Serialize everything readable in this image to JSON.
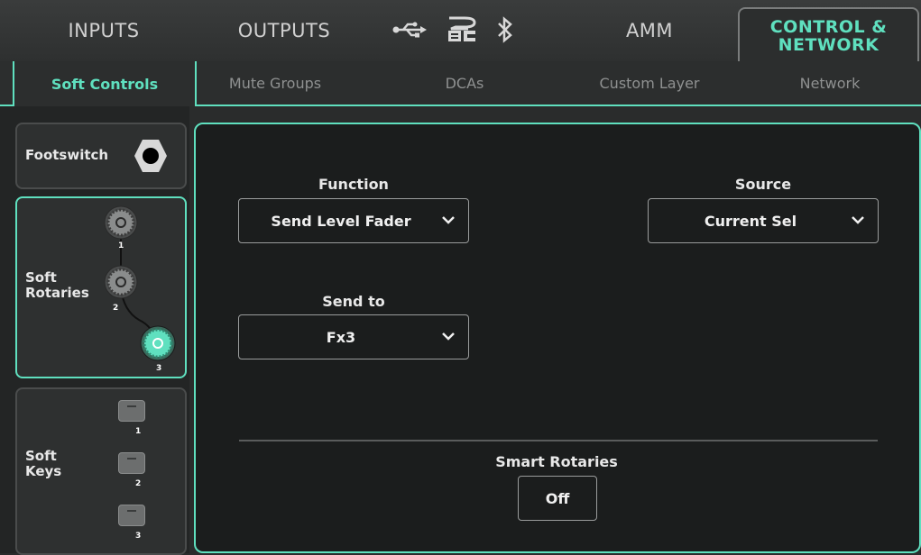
{
  "top_tabs": {
    "inputs": "INPUTS",
    "outputs": "OUTPUTS",
    "amm": "AMM",
    "control_line1": "CONTROL &",
    "control_line2": "NETWORK"
  },
  "top_icons": [
    "usb-icon",
    "sdhc-icon",
    "bluetooth-icon"
  ],
  "sub_tabs": [
    "Soft Controls",
    "Mute Groups",
    "DCAs",
    "Custom Layer",
    "Network"
  ],
  "left_panel": {
    "footswitch": "Footswitch",
    "rotaries_line1": "Soft",
    "rotaries_line2": "Rotaries",
    "keys_line1": "Soft",
    "keys_line2": "Keys",
    "rotary_numbers": [
      "1",
      "2",
      "3"
    ],
    "key_numbers": [
      "1",
      "2",
      "3"
    ],
    "selected_rotary": 3
  },
  "main": {
    "function_label": "Function",
    "function_value": "Send Level Fader",
    "source_label": "Source",
    "source_value": "Current Sel",
    "sendto_label": "Send to",
    "sendto_value": "Fx3",
    "smart_label": "Smart Rotaries",
    "smart_value": "Off"
  },
  "colors": {
    "accent": "#5fe0bf",
    "background": "#2a2c2c",
    "panel": "#1b1d1d"
  }
}
